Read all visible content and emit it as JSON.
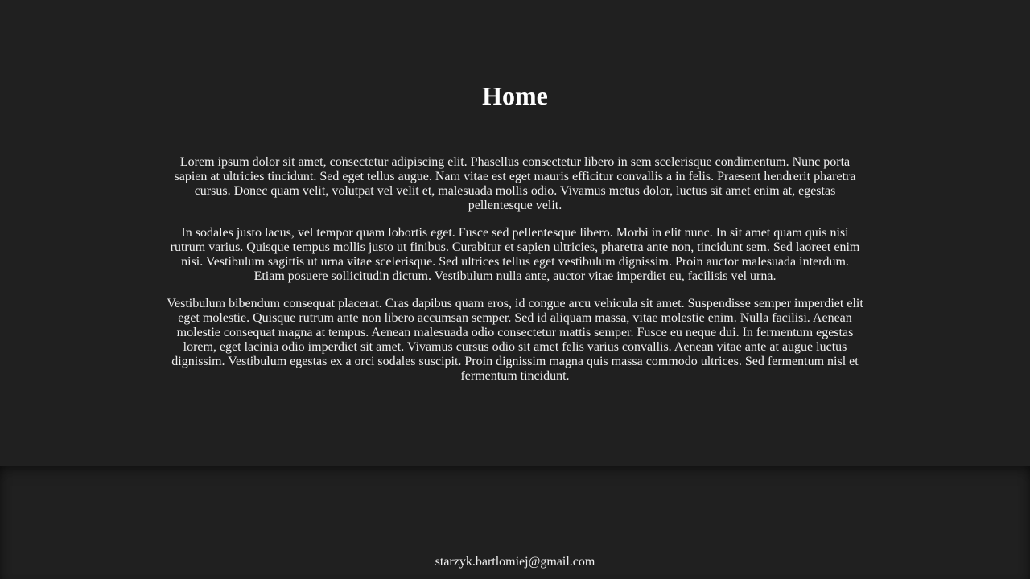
{
  "page": {
    "title": "Home"
  },
  "content": {
    "paragraphs": [
      "Lorem ipsum dolor sit amet, consectetur adipiscing elit. Phasellus consectetur libero in sem scelerisque condimentum. Nunc porta sapien at ultricies tincidunt. Sed eget tellus augue. Nam vitae est eget mauris efficitur convallis a in felis. Praesent hendrerit pharetra cursus. Donec quam velit, volutpat vel velit et, malesuada mollis odio. Vivamus metus dolor, luctus sit amet enim at, egestas pellentesque velit.",
      "In sodales justo lacus, vel tempor quam lobortis eget. Fusce sed pellentesque libero. Morbi in elit nunc. In sit amet quam quis nisi rutrum varius. Quisque tempus mollis justo ut finibus. Curabitur et sapien ultricies, pharetra ante non, tincidunt sem. Sed laoreet enim nisi. Vestibulum sagittis ut urna vitae scelerisque. Sed ultrices tellus eget vestibulum dignissim. Proin auctor malesuada interdum. Etiam posuere sollicitudin dictum. Vestibulum nulla ante, auctor vitae imperdiet eu, facilisis vel urna.",
      "Vestibulum bibendum consequat placerat. Cras dapibus quam eros, id congue arcu vehicula sit amet. Suspendisse semper imperdiet elit eget molestie. Quisque rutrum ante non libero accumsan semper. Sed id aliquam massa, vitae molestie enim. Nulla facilisi. Aenean molestie consequat magna at tempus. Aenean malesuada odio consectetur mattis semper. Fusce eu neque dui. In fermentum egestas lorem, eget lacinia odio imperdiet sit amet. Vivamus cursus odio sit amet felis varius convallis. Aenean vitae ante at augue luctus dignissim. Vestibulum egestas ex a orci sodales suscipit. Proin dignissim magna quis massa commodo ultrices. Sed fermentum nisl et fermentum tincidunt."
    ]
  },
  "footer": {
    "email": "starzyk.bartlomiej@gmail.com"
  },
  "colors": {
    "background": "#202020",
    "text": "#f0f0f0",
    "title": "#ffffff"
  }
}
